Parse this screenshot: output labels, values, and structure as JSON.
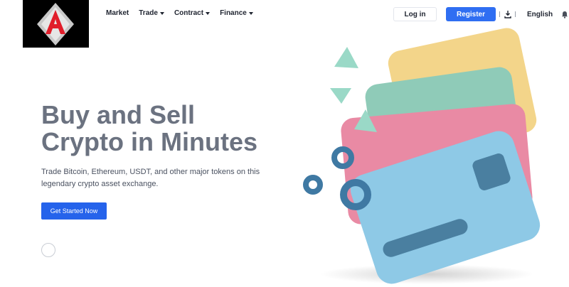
{
  "header": {
    "logo_name": "A",
    "nav": [
      {
        "label": "Market",
        "has_caret": false
      },
      {
        "label": "Trade",
        "has_caret": true
      },
      {
        "label": "Contract",
        "has_caret": true
      },
      {
        "label": "Finance",
        "has_caret": true
      }
    ],
    "login_label": "Log in",
    "register_label": "Register",
    "language": "English",
    "icons": [
      "download-icon",
      "bell-icon"
    ]
  },
  "hero": {
    "title": "Buy and Sell Crypto in Minutes",
    "subtitle": "Trade Bitcoin, Ethereum, USDT, and other major tokens on this legendary crypto asset exchange.",
    "cta_label": "Get Started Now"
  },
  "colors": {
    "accent": "#2f6ef2",
    "title_gray": "#6b7280",
    "card_yellow": "#f3d58a",
    "card_teal": "#8fcbb8",
    "card_pink": "#e98aa4",
    "card_blue": "#8ec9e6"
  }
}
